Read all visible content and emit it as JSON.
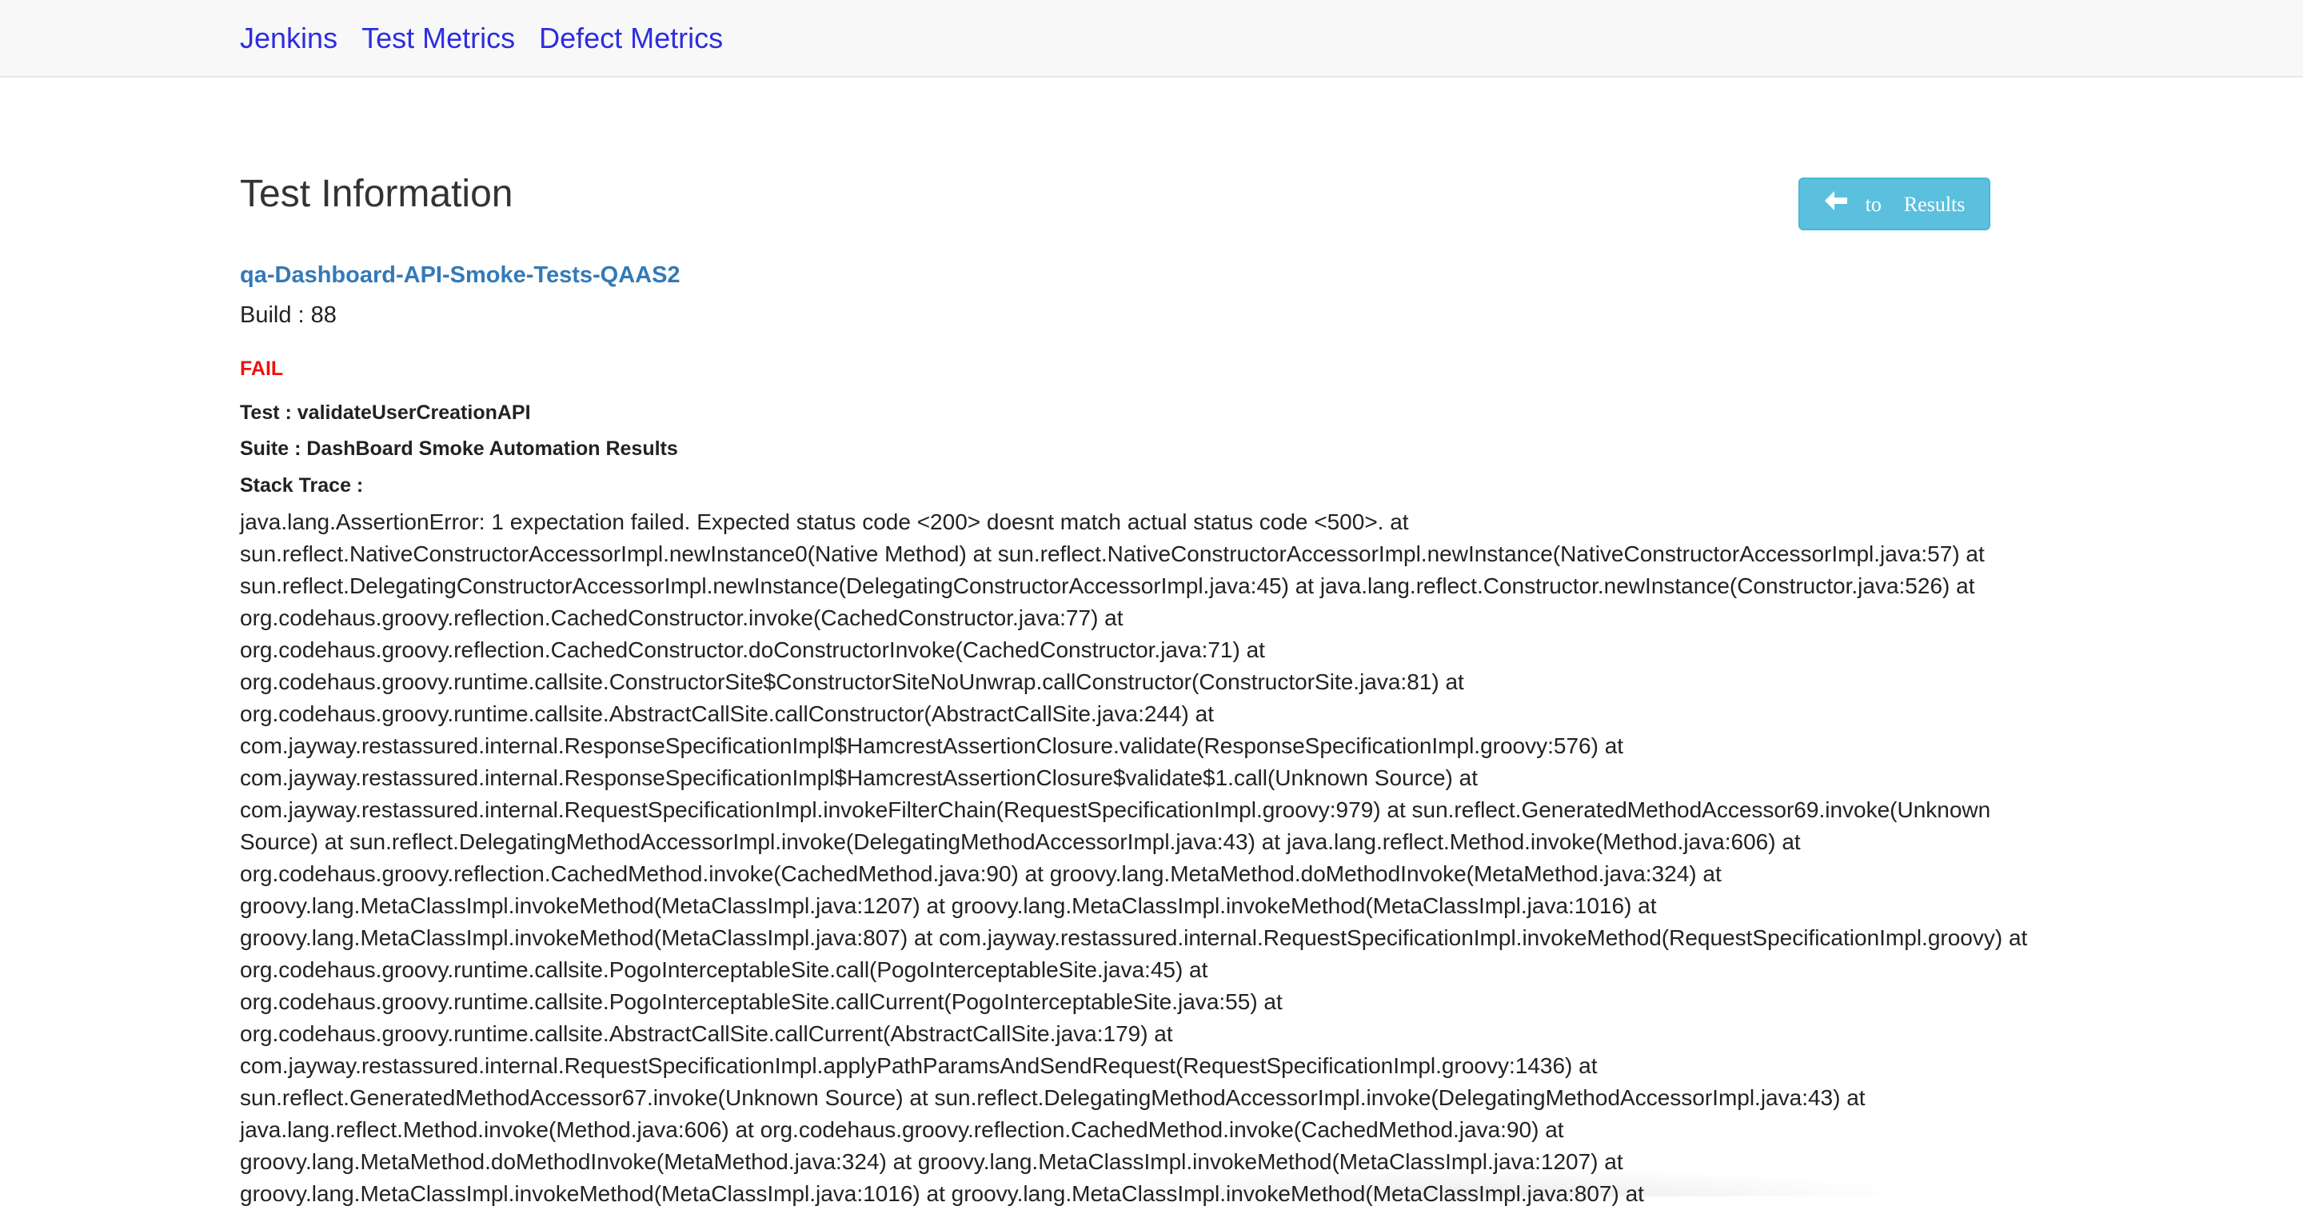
{
  "nav": {
    "links": [
      "Jenkins",
      "Test Metrics",
      "Defect Metrics"
    ]
  },
  "page": {
    "title": "Test Information",
    "back_button": {
      "icon": "arrow-left-icon",
      "word1": "to",
      "word2": "Results"
    },
    "job_name": "qa-Dashboard-API-Smoke-Tests-QAAS2",
    "build": "Build : 88",
    "status": "FAIL",
    "test": "Test : validateUserCreationAPI",
    "suite": "Suite : DashBoard Smoke Automation Results",
    "stack_trace_label": "Stack Trace :"
  },
  "colors": {
    "nav_link": "#2d2de0",
    "job_link": "#337ab7",
    "fail": "#ee1111",
    "button_bg": "#5bc0de"
  },
  "stack_trace_lines": [
    "java.lang.AssertionError: 1 expectation failed. Expected status code <200> doesnt match actual status code <500>. at",
    "sun.reflect.NativeConstructorAccessorImpl.newInstance0(Native Method) at sun.reflect.NativeConstructorAccessorImpl.newInstance(NativeConstructorAccessorImpl.java:57) at",
    "sun.reflect.DelegatingConstructorAccessorImpl.newInstance(DelegatingConstructorAccessorImpl.java:45) at java.lang.reflect.Constructor.newInstance(Constructor.java:526) at",
    "org.codehaus.groovy.reflection.CachedConstructor.invoke(CachedConstructor.java:77) at",
    "org.codehaus.groovy.reflection.CachedConstructor.doConstructorInvoke(CachedConstructor.java:71) at",
    "org.codehaus.groovy.runtime.callsite.ConstructorSite$ConstructorSiteNoUnwrap.callConstructor(ConstructorSite.java:81) at",
    "org.codehaus.groovy.runtime.callsite.AbstractCallSite.callConstructor(AbstractCallSite.java:244) at",
    "com.jayway.restassured.internal.ResponseSpecificationImpl$HamcrestAssertionClosure.validate(ResponseSpecificationImpl.groovy:576) at",
    "com.jayway.restassured.internal.ResponseSpecificationImpl$HamcrestAssertionClosure$validate$1.call(Unknown Source) at",
    "com.jayway.restassured.internal.RequestSpecificationImpl.invokeFilterChain(RequestSpecificationImpl.groovy:979) at sun.reflect.GeneratedMethodAccessor69.invoke(Unknown",
    "Source) at sun.reflect.DelegatingMethodAccessorImpl.invoke(DelegatingMethodAccessorImpl.java:43) at java.lang.reflect.Method.invoke(Method.java:606) at",
    "org.codehaus.groovy.reflection.CachedMethod.invoke(CachedMethod.java:90) at groovy.lang.MetaMethod.doMethodInvoke(MetaMethod.java:324) at",
    "groovy.lang.MetaClassImpl.invokeMethod(MetaClassImpl.java:1207) at groovy.lang.MetaClassImpl.invokeMethod(MetaClassImpl.java:1016) at",
    "groovy.lang.MetaClassImpl.invokeMethod(MetaClassImpl.java:807) at com.jayway.restassured.internal.RequestSpecificationImpl.invokeMethod(RequestSpecificationImpl.groovy) at",
    "org.codehaus.groovy.runtime.callsite.PogoInterceptableSite.call(PogoInterceptableSite.java:45) at",
    "org.codehaus.groovy.runtime.callsite.PogoInterceptableSite.callCurrent(PogoInterceptableSite.java:55) at",
    "org.codehaus.groovy.runtime.callsite.AbstractCallSite.callCurrent(AbstractCallSite.java:179) at",
    "com.jayway.restassured.internal.RequestSpecificationImpl.applyPathParamsAndSendRequest(RequestSpecificationImpl.groovy:1436) at",
    "sun.reflect.GeneratedMethodAccessor67.invoke(Unknown Source) at sun.reflect.DelegatingMethodAccessorImpl.invoke(DelegatingMethodAccessorImpl.java:43) at",
    "java.lang.reflect.Method.invoke(Method.java:606) at org.codehaus.groovy.reflection.CachedMethod.invoke(CachedMethod.java:90) at",
    "groovy.lang.MetaMethod.doMethodInvoke(MetaMethod.java:324) at groovy.lang.MetaClassImpl.invokeMethod(MetaClassImpl.java:1207) at",
    "groovy.lang.MetaClassImpl.invokeMethod(MetaClassImpl.java:1016) at groovy.lang.MetaClassImpl.invokeMethod(MetaClassImpl.java:807) at"
  ]
}
